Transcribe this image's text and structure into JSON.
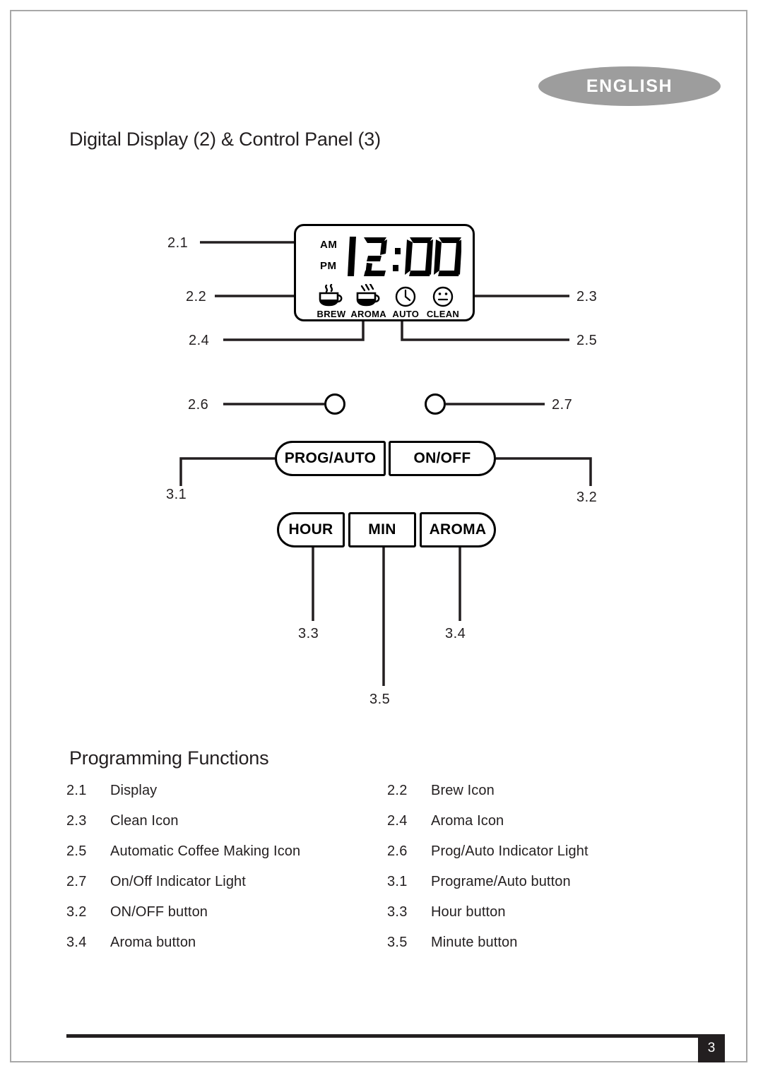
{
  "language_badge": {
    "label": "ENGLISH"
  },
  "headings": {
    "diagram_title": "Digital Display (2) & Control Panel (3)",
    "functions_title": "Programming Functions"
  },
  "display": {
    "am_label": "AM",
    "pm_label": "PM",
    "time": "12:00",
    "icons": [
      {
        "name": "brew-icon",
        "caption": "BREW"
      },
      {
        "name": "aroma-icon",
        "caption": "AROMA"
      },
      {
        "name": "auto-icon",
        "caption": "AUTO"
      },
      {
        "name": "clean-icon",
        "caption": "CLEAN"
      }
    ]
  },
  "buttons": {
    "prog_auto": "PROG/AUTO",
    "on_off": "ON/OFF",
    "hour": "HOUR",
    "min": "MIN",
    "aroma": "AROMA"
  },
  "callouts": {
    "c21": "2.1",
    "c22": "2.2",
    "c23": "2.3",
    "c24": "2.4",
    "c25": "2.5",
    "c26": "2.6",
    "c27": "2.7",
    "c31": "3.1",
    "c32": "3.2",
    "c33": "3.3",
    "c34": "3.4",
    "c35": "3.5"
  },
  "legend": [
    [
      {
        "num": "2.1",
        "label": "Display"
      },
      {
        "num": "2.2",
        "label": "Brew Icon"
      }
    ],
    [
      {
        "num": "2.3",
        "label": "Clean Icon"
      },
      {
        "num": "2.4",
        "label": "Aroma Icon"
      }
    ],
    [
      {
        "num": "2.5",
        "label": "Automatic Coffee Making Icon"
      },
      {
        "num": "2.6",
        "label": "Prog/Auto Indicator Light"
      }
    ],
    [
      {
        "num": "2.7",
        "label": "On/Off Indicator Light"
      },
      {
        "num": "3.1",
        "label": "Programe/Auto button"
      }
    ],
    [
      {
        "num": "3.2",
        "label": "ON/OFF button"
      },
      {
        "num": "3.3",
        "label": "Hour button"
      }
    ],
    [
      {
        "num": "3.4",
        "label": "Aroma button"
      },
      {
        "num": "3.5",
        "label": "Minute button"
      }
    ]
  ],
  "footer": {
    "page_number": "3"
  },
  "colors": {
    "ink": "#231f20",
    "badge_gray": "#9d9d9d",
    "page_border": "#a8a8a8"
  }
}
